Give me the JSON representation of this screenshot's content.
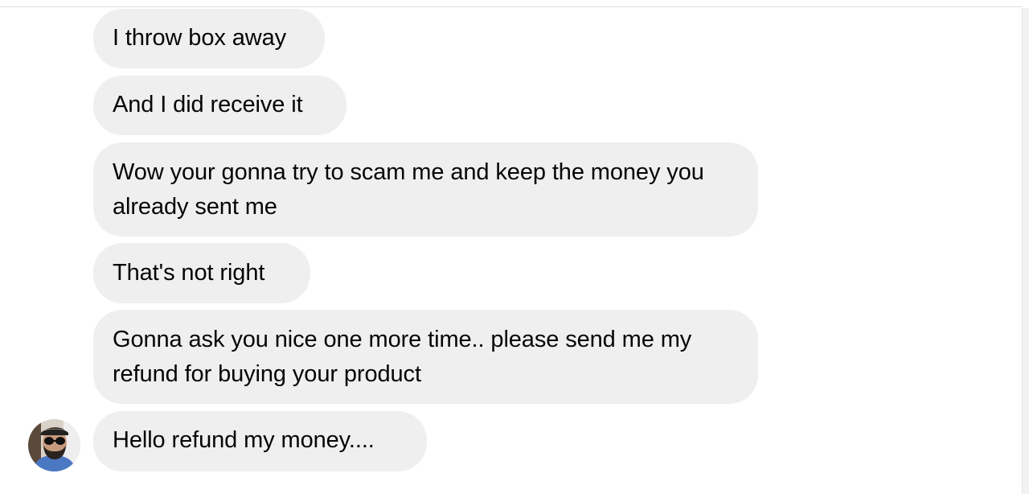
{
  "conversation": {
    "messages": [
      {
        "text": "I throw box away"
      },
      {
        "text": "And I did receive it"
      },
      {
        "text": "Wow your gonna try to scam me and keep the money you already sent me"
      },
      {
        "text": "That's not right"
      },
      {
        "text": "Gonna ask you nice one more time.. please send me my refund for buying your product"
      },
      {
        "text": "Hello refund my money...."
      }
    ],
    "sender_avatar": {
      "icon": "user-avatar",
      "description_color": "#4a78c2"
    }
  },
  "colors": {
    "bubble_background": "#efefef",
    "text": "#050505",
    "divider": "#dadde1"
  }
}
